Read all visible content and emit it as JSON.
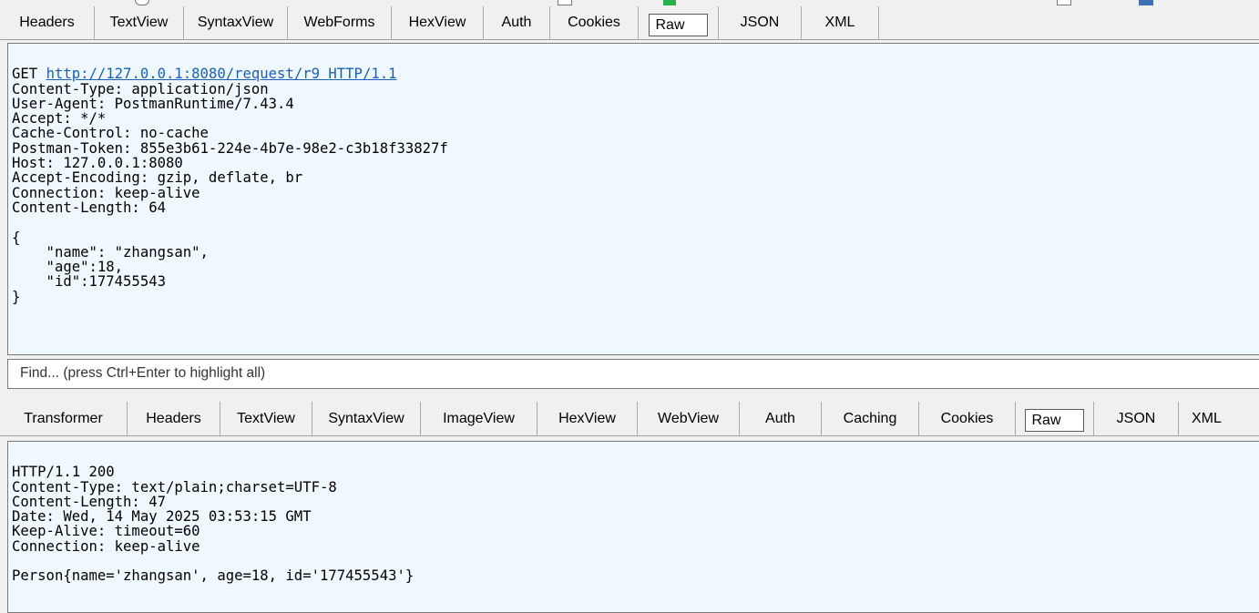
{
  "request": {
    "tabs": [
      "Headers",
      "TextView",
      "SyntaxView",
      "WebForms",
      "HexView",
      "Auth",
      "Cookies",
      "Raw",
      "JSON",
      "XML"
    ],
    "active_tab": "Raw",
    "request_line": {
      "method": "GET",
      "url": "http://127.0.0.1:8080/request/r9",
      "version": "HTTP/1.1"
    },
    "lines": [
      "Content-Type: application/json",
      "User-Agent: PostmanRuntime/7.43.4",
      "Accept: */*",
      "Cache-Control: no-cache",
      "Postman-Token: 855e3b61-224e-4b7e-98e2-c3b18f33827f",
      "Host: 127.0.0.1:8080",
      "Accept-Encoding: gzip, deflate, br",
      "Connection: keep-alive",
      "Content-Length: 64",
      "",
      "{",
      "    \"name\": \"zhangsan\",",
      "    \"age\":18,",
      "    \"id\":177455543",
      "}"
    ]
  },
  "find": {
    "placeholder": "Find... (press Ctrl+Enter to highlight all)"
  },
  "response": {
    "tabs": [
      "Transformer",
      "Headers",
      "TextView",
      "SyntaxView",
      "ImageView",
      "HexView",
      "WebView",
      "Auth",
      "Caching",
      "Cookies",
      "Raw",
      "JSON",
      "XML"
    ],
    "active_tab": "Raw",
    "lines": [
      "HTTP/1.1 200",
      "Content-Type: text/plain;charset=UTF-8",
      "Content-Length: 47",
      "Date: Wed, 14 May 2025 03:53:15 GMT",
      "Keep-Alive: timeout=60",
      "Connection: keep-alive",
      "",
      "Person{name='zhangsan', age=18, id='177455543'}"
    ]
  }
}
